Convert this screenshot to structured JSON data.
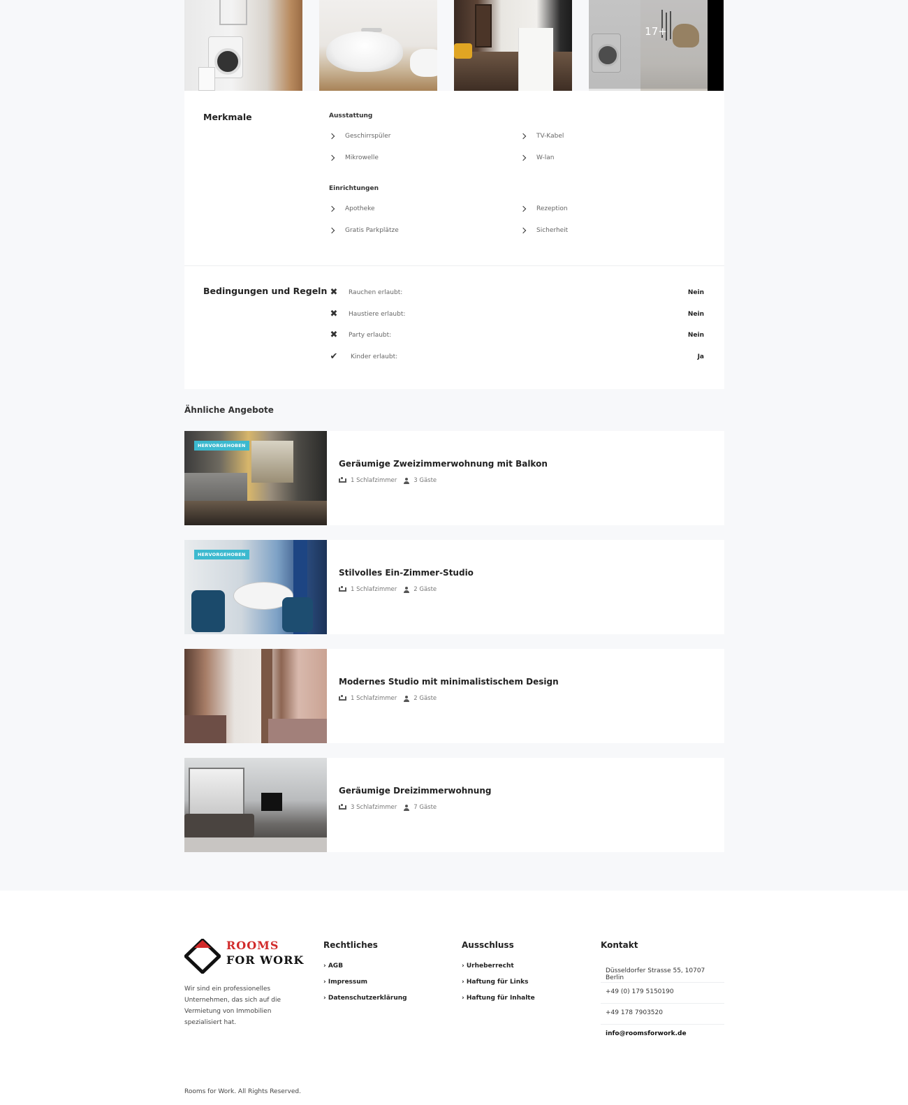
{
  "gallery": {
    "more_label": "17+"
  },
  "features": {
    "title": "Merkmale",
    "groups": [
      {
        "title": "Ausstattung",
        "items": [
          "Geschirrspüler",
          "TV-Kabel",
          "Mikrowelle",
          "W-lan"
        ]
      },
      {
        "title": "Einrichtungen",
        "items": [
          "Apotheke",
          "Rezeption",
          "Gratis Parkplätze",
          "Sicherheit"
        ]
      }
    ]
  },
  "rules": {
    "title": "Bedingungen und Regeln",
    "items": [
      {
        "label": "Rauchen erlaubt:",
        "value": "Nein",
        "icon": "cross-icon"
      },
      {
        "label": "Haustiere erlaubt:",
        "value": "Nein",
        "icon": "cross-icon"
      },
      {
        "label": "Party erlaubt:",
        "value": "Nein",
        "icon": "cross-icon"
      },
      {
        "label": "Kinder erlaubt:",
        "value": "Ja",
        "icon": "check-icon"
      }
    ]
  },
  "similar": {
    "title": "Ähnliche Angebote",
    "listings": [
      {
        "badge": "HERVORGEHOBEN",
        "title": "Geräumige Zweizimmerwohnung mit Balkon",
        "bedrooms": "1 Schlafzimmer",
        "guests": "3 Gäste"
      },
      {
        "badge": "HERVORGEHOBEN",
        "title": "Stilvolles Ein-Zimmer-Studio",
        "bedrooms": "1 Schlafzimmer",
        "guests": "2 Gäste"
      },
      {
        "badge": "",
        "title": "Modernes Studio mit minimalistischem Design",
        "bedrooms": "1 Schlafzimmer",
        "guests": "2 Gäste"
      },
      {
        "badge": "",
        "title": "Geräumige Dreizimmerwohnung",
        "bedrooms": "3 Schlafzimmer",
        "guests": "7 Gäste"
      }
    ]
  },
  "footer": {
    "logo_line1": "ROOMS",
    "logo_line2": "FOR WORK",
    "description": "Wir sind ein professionelles Unternehmen, das sich auf die Vermietung von Immobilien spezialisiert hat.",
    "columns": [
      {
        "title": "Rechtliches",
        "links": [
          "AGB",
          "Impressum",
          "Datenschutzerklärung"
        ]
      },
      {
        "title": "Ausschluss",
        "links": [
          "Urheberrecht",
          "Haftung für Links",
          "Haftung für Inhalte"
        ]
      }
    ],
    "contact": {
      "title": "Kontakt",
      "address": "Düsseldorfer Strasse 55, 10707 Berlin",
      "phone1": "+49 (0) 179 5150190",
      "phone2": "+49 178 7903520",
      "email": "info@roomsforwork.de"
    },
    "copyright": "Rooms for Work. All Rights Reserved.",
    "brand_colors": {
      "red": "#d12a2a",
      "dark": "#111111"
    }
  },
  "colors": {
    "badge": "#3cb9cf",
    "page_bg": "#f7f8fa"
  }
}
